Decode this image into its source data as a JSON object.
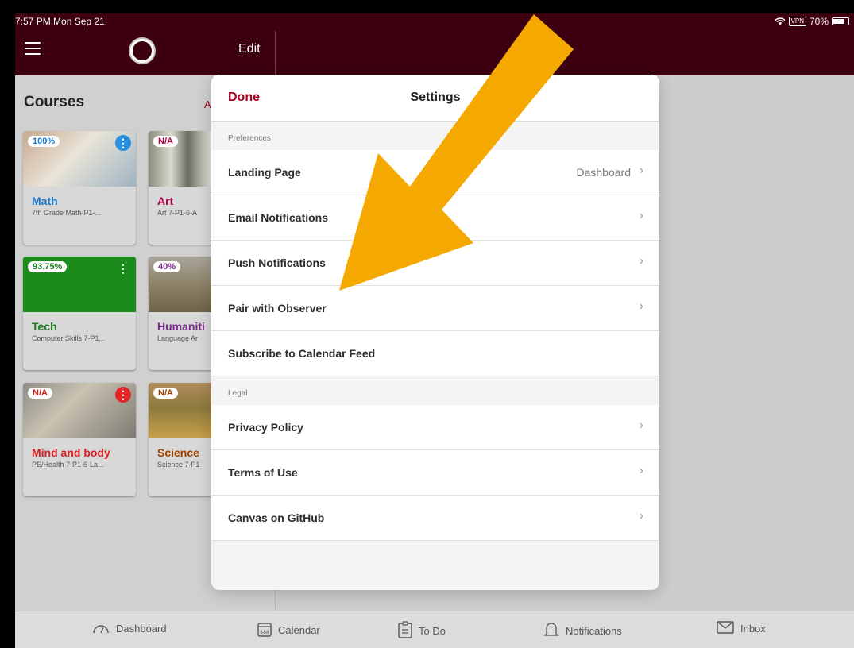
{
  "status": {
    "time": "7:57 PM  Mon Sep 21",
    "vpn": "VPN",
    "battery": "70%"
  },
  "header": {
    "edit": "Edit"
  },
  "courses": {
    "title": "Courses",
    "all_link": "A",
    "cards": [
      {
        "grade": "100%",
        "name": "Math",
        "sub": "7th Grade Math-P1-...",
        "name_color": "#1b77c9",
        "grade_color": "#1b77c9",
        "kebab_color": "#2b8fe0"
      },
      {
        "grade": "N/A",
        "name": "Art",
        "sub": "Art 7-P1-6-A",
        "name_color": "#b0004a",
        "grade_color": "#b0004a",
        "kebab_color": ""
      },
      {
        "grade": "93.75%",
        "name": "Tech",
        "sub": "Computer Skills 7-P1...",
        "name_color": "#1f7a1f",
        "grade_color": "#1f7a1f",
        "kebab_color": "transparent"
      },
      {
        "grade": "40%",
        "name": "Humaniti",
        "sub": "Language Ar",
        "name_color": "#7a2a8a",
        "grade_color": "#7a2a8a",
        "kebab_color": ""
      },
      {
        "grade": "N/A",
        "name": "Mind and body",
        "sub": "PE/Health 7-P1-6-La...",
        "name_color": "#d62020",
        "grade_color": "#d62020",
        "kebab_color": "#e02626"
      },
      {
        "grade": "N/A",
        "name": "Science",
        "sub": "Science 7-P1",
        "name_color": "#a04000",
        "grade_color": "#a04000",
        "kebab_color": ""
      }
    ]
  },
  "settings": {
    "done": "Done",
    "title": "Settings",
    "sections": [
      {
        "label": "Preferences",
        "rows": [
          {
            "label": "Landing Page",
            "value": "Dashboard",
            "chevron": true
          },
          {
            "label": "Email Notifications",
            "value": "",
            "chevron": true
          },
          {
            "label": "Push Notifications",
            "value": "",
            "chevron": true
          },
          {
            "label": "Pair with Observer",
            "value": "",
            "chevron": true
          },
          {
            "label": "Subscribe to Calendar Feed",
            "value": "",
            "chevron": false
          }
        ]
      },
      {
        "label": "Legal",
        "rows": [
          {
            "label": "Privacy Policy",
            "value": "",
            "chevron": true
          },
          {
            "label": "Terms of Use",
            "value": "",
            "chevron": true
          },
          {
            "label": "Canvas on GitHub",
            "value": "",
            "chevron": true
          }
        ]
      }
    ]
  },
  "tabbar": [
    {
      "label": "Dashboard",
      "icon": "dashboard-icon"
    },
    {
      "label": "Calendar",
      "icon": "calendar-icon"
    },
    {
      "label": "To Do",
      "icon": "todo-icon"
    },
    {
      "label": "Notifications",
      "icon": "bell-icon"
    },
    {
      "label": "Inbox",
      "icon": "envelope-icon"
    }
  ],
  "colors": {
    "brand": "#3d0010",
    "accent": "#a4001e",
    "arrow": "#f5a800"
  }
}
